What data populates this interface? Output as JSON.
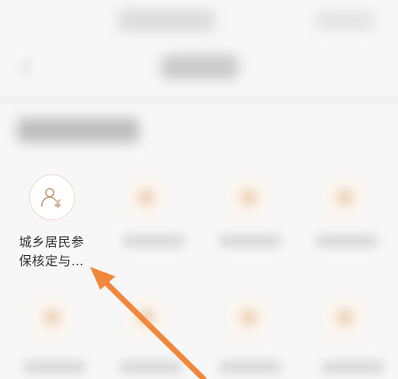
{
  "focused_item": {
    "label_line1": "城乡居民参",
    "label_line2": "保核定与…",
    "icon": "person-yuan-icon"
  },
  "colors": {
    "accent": "#F0873B",
    "icon_stroke": "#C9A27F"
  }
}
